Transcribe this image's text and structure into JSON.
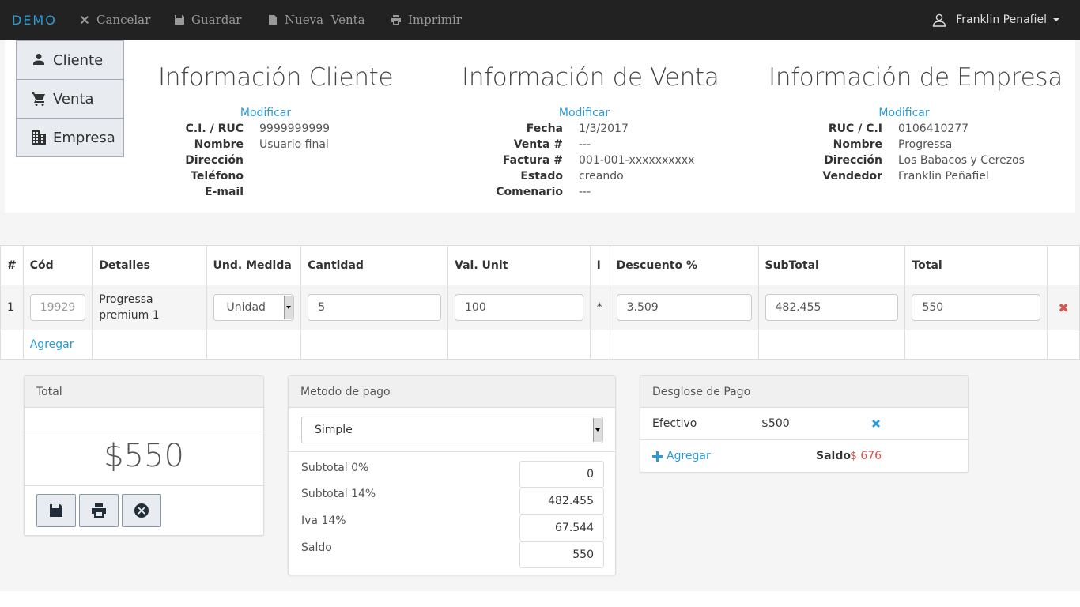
{
  "nav": {
    "brand": "DEMO",
    "cancel": "Cancelar",
    "save": "Guardar",
    "new_sale": "Nueva  Venta",
    "print": "Imprimir",
    "user": "Franklin Penafiel"
  },
  "side_tabs": [
    {
      "label": "Cliente",
      "icon": "user-icon"
    },
    {
      "label": "Venta",
      "icon": "cart-icon"
    },
    {
      "label": "Empresa",
      "icon": "building-icon"
    }
  ],
  "client": {
    "title": "Información Cliente",
    "modify": "Modificar",
    "rows": [
      {
        "k": "C.I. / RUC",
        "v": "9999999999"
      },
      {
        "k": "Nombre",
        "v": "Usuario final"
      },
      {
        "k": "Dirección",
        "v": ""
      },
      {
        "k": "Teléfono",
        "v": ""
      },
      {
        "k": "E-mail",
        "v": ""
      }
    ]
  },
  "sale": {
    "title": "Información de Venta",
    "modify": "Modificar",
    "rows": [
      {
        "k": "Fecha",
        "v": "1/3/2017"
      },
      {
        "k": "Venta #",
        "v": "---"
      },
      {
        "k": "Factura #",
        "v": "001-001-xxxxxxxxxx"
      },
      {
        "k": "Estado",
        "v": "creando"
      },
      {
        "k": "Comenario",
        "v": "---"
      }
    ]
  },
  "company": {
    "title": "Información de Empresa",
    "modify": "Modificar",
    "rows": [
      {
        "k": "RUC / C.I",
        "v": "0106410277"
      },
      {
        "k": "Nombre",
        "v": "Progressa"
      },
      {
        "k": "Dirección",
        "v": "Los Babacos y Cerezos"
      },
      {
        "k": "Vendedor",
        "v": "Franklin Peñafiel"
      }
    ]
  },
  "table": {
    "headers": [
      "#",
      "Cód",
      "Detalles",
      "Und. Medida",
      "Cantidad",
      "Val. Unit",
      "I",
      "Descuento %",
      "SubTotal",
      "Total",
      ""
    ],
    "row": {
      "num": "1",
      "code": "19929",
      "details": "Progressa premium 1",
      "unit": "Unidad",
      "qty": "5",
      "unit_val": "100",
      "iva": "*",
      "discount": "3.509",
      "subtotal": "482.455",
      "total": "550",
      "delete": "✖"
    },
    "add": "Agregar"
  },
  "total_panel": {
    "title": "Total",
    "amount": "$550"
  },
  "payment_panel": {
    "title": "Metodo de pago",
    "method": "Simple",
    "rows": [
      {
        "label": "Subtotal 0%",
        "value": "0"
      },
      {
        "label": "Subtotal 14%",
        "value": "482.455"
      },
      {
        "label": "Iva 14%",
        "value": "67.544"
      },
      {
        "label": "Saldo",
        "value": "550"
      }
    ]
  },
  "breakdown_panel": {
    "title": "Desglose de Pago",
    "method": "Efectivo",
    "amount": "$500",
    "add": "Agregar",
    "saldo_label": "Saldo",
    "saldo_value": "$ 676"
  }
}
